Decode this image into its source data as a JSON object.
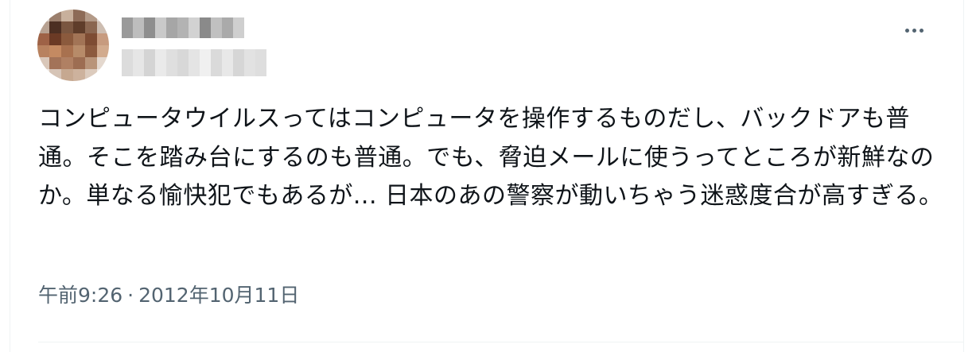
{
  "tweet": {
    "text": "コンピュータウイルスってはコンピュータを操作するものだし、バックドアも普通。そこを踏み台にするのも普通。でも、脅迫メールに使うってところが新鮮なのか。単なる愉快犯でもあるが... 日本のあの警察が動いちゃう迷惑度合が高すぎる。",
    "time": "午前9:26",
    "separator": "·",
    "date": "2012年10月11日"
  },
  "more_icon": "more-horizontal-icon",
  "colors": {
    "text": "#0f1419",
    "secondary": "#536471",
    "border": "#eff3f4"
  }
}
